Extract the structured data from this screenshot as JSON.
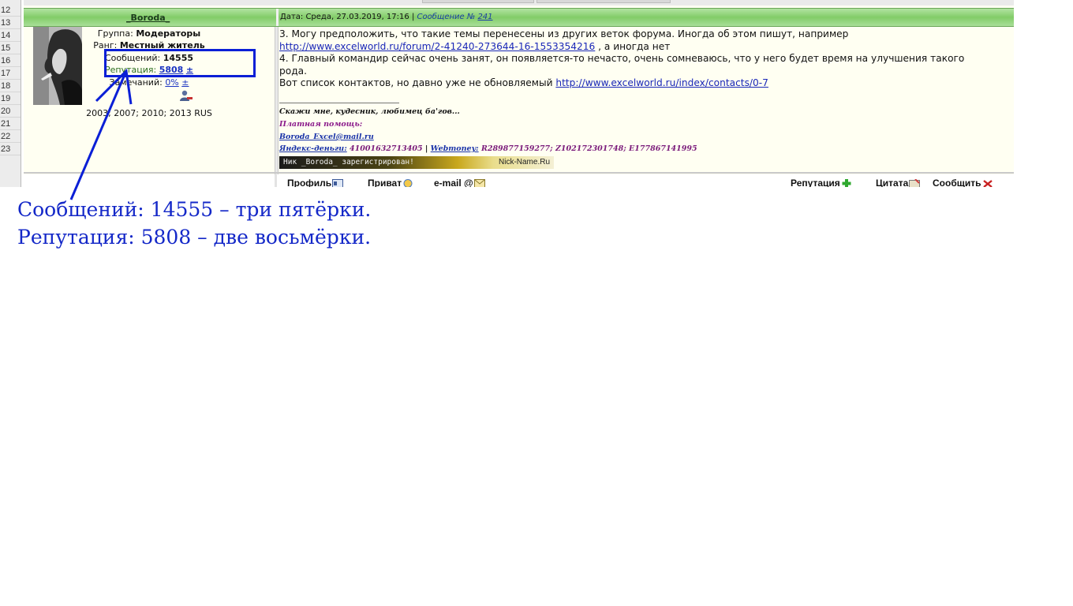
{
  "sheet": {
    "row_numbers": [
      "12",
      "13",
      "14",
      "15",
      "16",
      "17",
      "18",
      "19",
      "20",
      "21",
      "22",
      "23"
    ]
  },
  "post": {
    "author": "_Boroda_",
    "date_label": "Дата: Среда, 27.03.2019, 17:16",
    "separator": "|",
    "message_label": "Сообщение №",
    "message_number": "241",
    "group_label": "Группа:",
    "group_value": "Модераторы",
    "rank_label": "Ранг:",
    "rank_value": "Местный житель",
    "messages_label": "Сообщений:",
    "messages_value": "14555",
    "reputation_label": "Репутация:",
    "reputation_value": "5808",
    "reputation_pm": "±",
    "warnings_label": "Замечаний:",
    "warnings_value": "0%",
    "warnings_pm": "±",
    "versions": "2003; 2007; 2010; 2013 RUS",
    "body": {
      "line1": "3. Могу предположить, что такие темы перенесены из других веток форума. Иногда об этом пишут, например",
      "link1": "http://www.excelworld.ru/forum/2-41240-273644-16-1553354216",
      "line2_tail": " , а иногда нет",
      "line3": "4. Главный командир сейчас очень занят, он появляется-то нечасто, очень сомневаюсь, что у него будет время на улучшения такого",
      "line4": "рода.",
      "line5": "Вот список контактов, но давно уже не обновляемый ",
      "link2": "http://www.excelworld.ru/index/contacts/0-7"
    },
    "signature": {
      "quote": "Скажи мне, кудесник, любимец ба'гов...",
      "paid_help": "Платная помощь:",
      "email": "Boroda_Excel@mail.ru",
      "yandex_label": "Яндекс-деньги:",
      "yandex_value": "41001632713405",
      "sep": "|",
      "webmoney_label": "Webmoney:",
      "webmoney_value": "R289877159277; Z102172301748; E177867141995",
      "nick_banner": "Ник _Boroda_ зарегистрирован!",
      "nick_site": "Nick-Name.Ru"
    },
    "footer": {
      "profile": "Профиль",
      "private": "Приват",
      "email": "e-mail",
      "reputation": "Репутация",
      "quote": "Цитата",
      "report": "Сообщить"
    }
  },
  "annotation": {
    "line1": "Сообщений: 14555 – три пятёрки.",
    "line2": "Репутация: 5808 – две восьмёрки.",
    "accent_color": "#1428c8"
  }
}
